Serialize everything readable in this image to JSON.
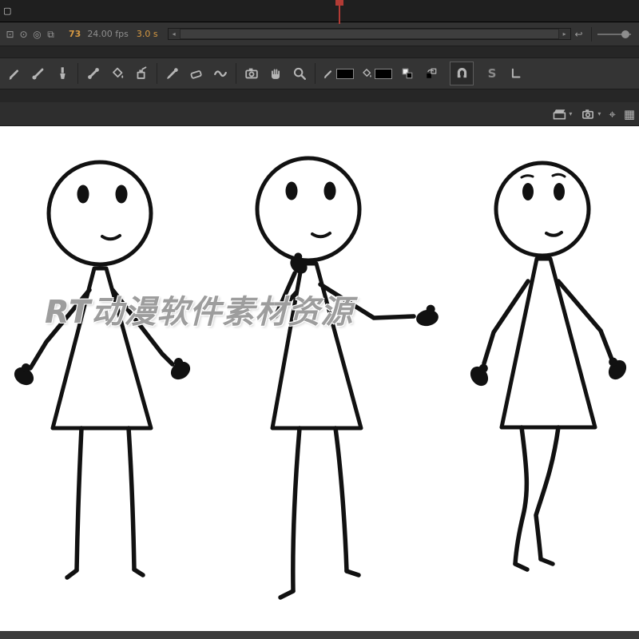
{
  "colors": {
    "toolbar_bg": "#333333",
    "ruler_bg": "#1f1f1f",
    "panel_bg": "#2e2e2e",
    "canvas_bg": "#ffffff",
    "accent_orange": "#d79a43",
    "playhead_red": "#b23b35",
    "icon_gray": "#b5b5b5",
    "figure_ink": "#111111",
    "stroke_color": "#000000",
    "fill_color": "#000000"
  },
  "timeline": {
    "current_frame": "73",
    "frame_rate": "24.00 fps",
    "elapsed_time": "3.0 s"
  },
  "icons": {
    "document": "▢",
    "center_frame": "⊡",
    "onion_skin": "⊙",
    "onion_skin_outlines": "◎",
    "edit_multiple_frames": "⧉",
    "scroll_left": "◂",
    "scroll_right": "▸",
    "loop": "↩",
    "smooth": "S",
    "crosshair": "⌖",
    "grid": "▦",
    "chevron_down": "▾"
  },
  "tools": [
    "pencil",
    "brush",
    "paintbrush",
    "bone",
    "paint-bucket",
    "ink-bottle",
    "eyedropper",
    "eraser",
    "width",
    "camera",
    "hand",
    "zoom",
    "stroke-color",
    "fill-color",
    "black-white",
    "swap-colors",
    "snap-magnet",
    "smooth",
    "straighten"
  ],
  "watermark": {
    "text": "RT动漫软件素材资源"
  },
  "stage": {
    "figures": [
      "stick-figure-front",
      "stick-figure-hand-on-chin",
      "stick-figure-knock-knees"
    ]
  }
}
